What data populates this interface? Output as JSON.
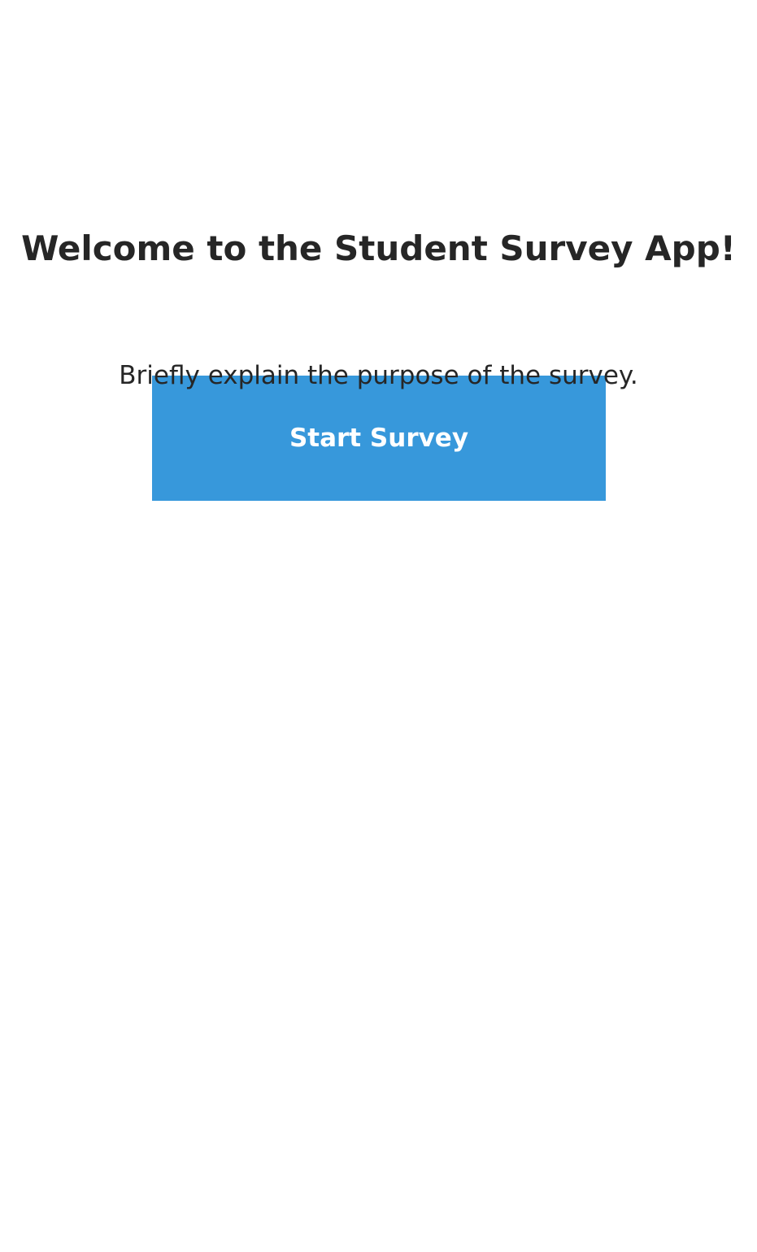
{
  "welcome": {
    "title": "Welcome to the Student Survey App!",
    "description": "Briefly explain the purpose of the survey.",
    "start_button_label": "Start Survey"
  },
  "colors": {
    "accent": "#3798db",
    "text": "#262626",
    "background": "#ffffff",
    "button_text": "#ffffff"
  }
}
